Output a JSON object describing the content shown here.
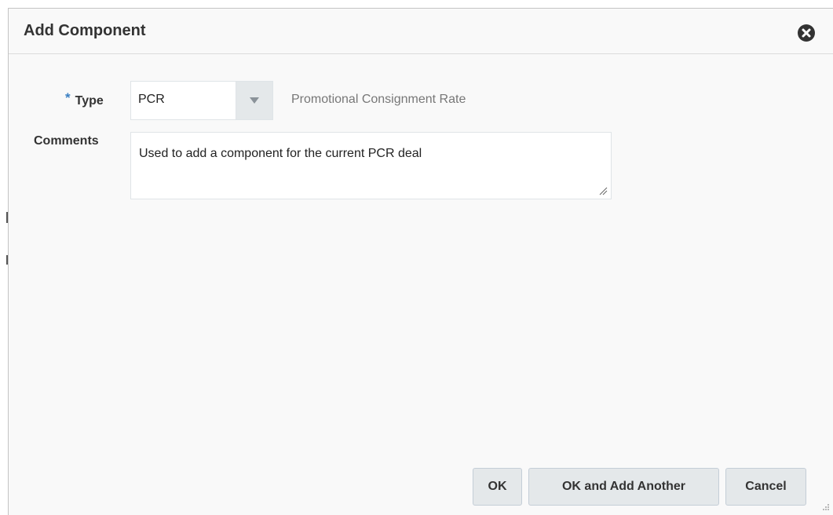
{
  "dialog": {
    "title": "Add Component",
    "close_icon": "close-circle-icon"
  },
  "form": {
    "type": {
      "required_marker": "*",
      "label": "Type",
      "value": "PCR",
      "dropdown_icon": "chevron-down-icon",
      "description": "Promotional Consignment Rate"
    },
    "comments": {
      "label": "Comments",
      "value": "Used to add a component for the current PCR deal",
      "resize_icon": "resize-grip-icon"
    }
  },
  "buttons": {
    "ok": "OK",
    "ok_and_add_another": "OK and Add Another",
    "cancel": "Cancel"
  },
  "colors": {
    "accent": "#3a7fc2",
    "button_bg": "#e4e8ea",
    "text": "#333333"
  }
}
